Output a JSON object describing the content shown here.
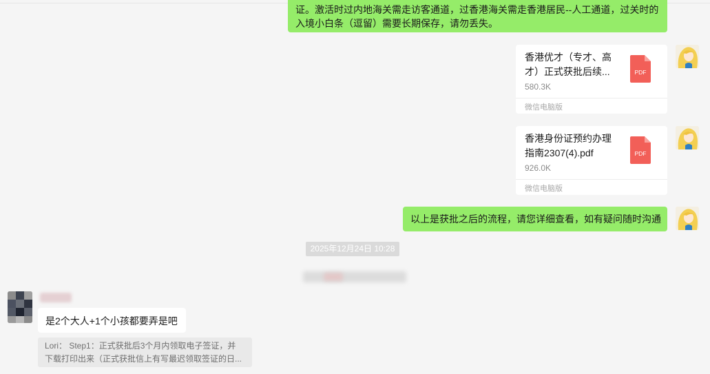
{
  "messages": {
    "top_message": {
      "line1": "证。激活时过内地海关需走访客通道，过香港海关需走香港居民--人工通道，过关时的",
      "line2": "入境小白条（逗留）需要长期保存，请勿丢失。"
    },
    "file1": {
      "name_line1": "香港优才（专才、高",
      "name_line2": "才）正式获批后续...",
      "size": "580.3K",
      "source": "微信电脑版",
      "icon_label": "PDF"
    },
    "file2": {
      "name_line1": "香港身份证预约办理",
      "name_line2": "指南2307(4).pdf",
      "size": "926.0K",
      "source": "微信电脑版",
      "icon_label": "PDF"
    },
    "process_message": "以上是获批之后的流程，请您详细查看，如有疑问随时沟通",
    "timestamp": "2025年12月24日 10:28",
    "incoming_message": "是2个大人+1个小孩都要弄是吧",
    "quote": {
      "line1": "Lori：  Step1：正式获批后3个月内领取电子签证，并",
      "line2": "下载打印出来（正式获批信上有写最迟领取签证的日..."
    }
  },
  "colors": {
    "outgoing_bubble": "#95ec69",
    "incoming_bubble": "#ffffff",
    "pdf_icon": "#f25f58",
    "background": "#f5f5f5"
  },
  "icons": {
    "file_icon": "pdf-file-icon",
    "self_avatar": "blonde-princess-avatar",
    "contact_avatar": "pixelated-avatar"
  }
}
